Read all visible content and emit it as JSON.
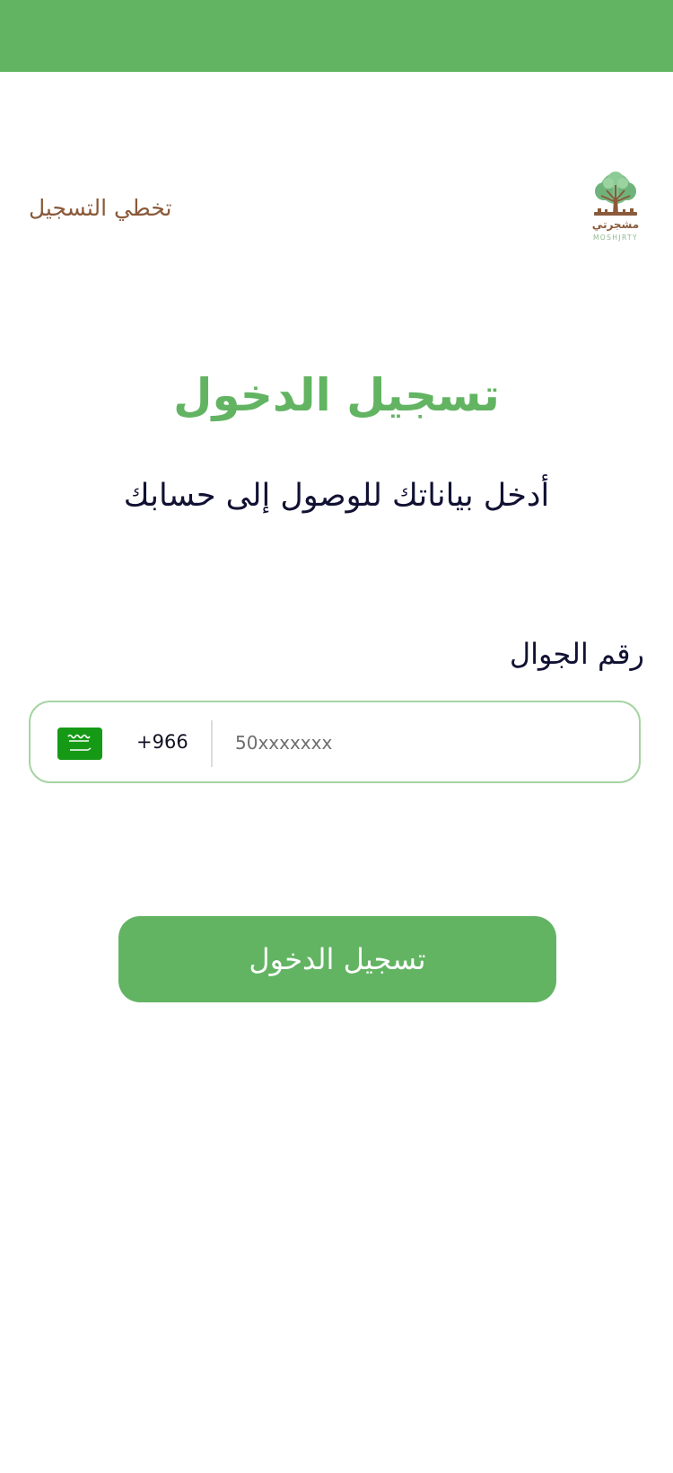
{
  "header": {
    "status_bar_color": "#62b462"
  },
  "logo": {
    "icon": "tree-logo-icon",
    "wordmark": "مشجرتي",
    "wordmark_latin": "MOSHJRTY"
  },
  "skip_link": {
    "label": "تخطي التسجيل"
  },
  "login": {
    "title": "تسجيل الدخول",
    "subtitle": "أدخل بياناتك للوصول إلى حسابك",
    "phone_label": "رقم الجوال",
    "country_flag_icon": "saudi-flag-icon",
    "dial_code": "+966",
    "phone_value": "",
    "phone_placeholder": "50xxxxxxx",
    "submit_label": "تسجيل الدخول"
  },
  "colors": {
    "accent_green": "#62b462",
    "brown": "#8a5a3a",
    "text_dark": "#111133",
    "input_border": "#a6d4a2"
  }
}
